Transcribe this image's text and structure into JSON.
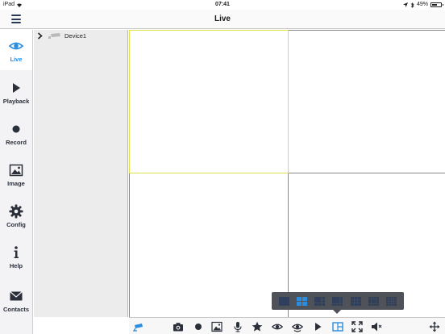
{
  "status": {
    "carrier": "iPad",
    "time": "07:41",
    "battery": "49%",
    "battery_level": 0.49
  },
  "header": {
    "title": "Live"
  },
  "sidebar": {
    "items": [
      {
        "label": "Live",
        "icon": "eye-icon",
        "active": true
      },
      {
        "label": "Playback",
        "icon": "play-icon"
      },
      {
        "label": "Record",
        "icon": "record-dot-icon"
      },
      {
        "label": "Image",
        "icon": "image-icon"
      },
      {
        "label": "Config",
        "icon": "gear-icon"
      },
      {
        "label": "Help",
        "icon": "info-icon"
      },
      {
        "label": "Contacts",
        "icon": "envelope-icon"
      }
    ]
  },
  "device_tree": {
    "devices": [
      {
        "name": "Device1",
        "icon": "camera-icon"
      }
    ]
  },
  "grid": {
    "layout": "2x2",
    "selected_cell": 1
  },
  "split_options": [
    "1-split",
    "4-split",
    "6-split",
    "8-split",
    "9-split",
    "13-split",
    "16-split"
  ],
  "split_selected": "4-split",
  "toolbar": {
    "buttons": [
      "ptz-camera-icon",
      "snapshot-camera-icon",
      "record-dot-icon",
      "image-icon",
      "microphone-icon",
      "star-icon",
      "eye-icon",
      "eye-all-icon",
      "play-icon",
      "split-screen-icon",
      "fullscreen-icon",
      "mute-speaker-icon",
      "move-arrows-icon"
    ]
  },
  "colors": {
    "accent": "#2a8de0",
    "selected_border": "#e2e04a",
    "popup_bg": "#4f5359",
    "icon_dark": "#2a2f3a"
  }
}
